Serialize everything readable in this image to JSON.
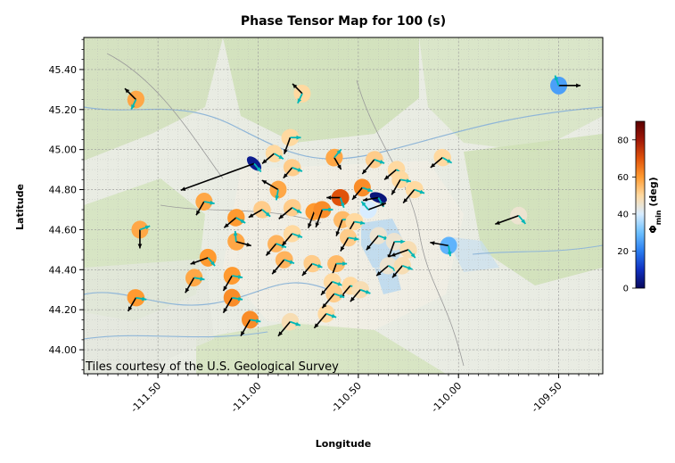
{
  "chart_data": {
    "type": "scatter",
    "title": "Phase Tensor Map for 100 (s)",
    "xlabel": "Longitude",
    "ylabel": "Latitude",
    "xlim": [
      -111.87,
      -109.28
    ],
    "ylim": [
      43.88,
      45.56
    ],
    "xticks": [
      "-111.50",
      "-111.00",
      "-110.50",
      "-110.00",
      "-109.50"
    ],
    "yticks": [
      "44.00",
      "44.20",
      "44.40",
      "44.60",
      "44.80",
      "45.00",
      "45.20",
      "45.40"
    ],
    "grid": true,
    "basemap_credit": "Tiles courtesy of the U.S. Geological Survey",
    "colorbar": {
      "label": "Φmin (deg)",
      "label_main": "Φ",
      "label_sub": "min",
      "label_rest": " (deg)",
      "min": 0,
      "max": 90,
      "ticks": [
        "0",
        "20",
        "40",
        "60",
        "80"
      ],
      "colors": [
        "#08085c",
        "#1030c0",
        "#2a7df0",
        "#6cc0ff",
        "#d8ecff",
        "#ffd9a0",
        "#ff9a30",
        "#e0520a",
        "#a01808",
        "#5a0000"
      ]
    },
    "stations": [
      {
        "lon": -111.61,
        "lat": 45.25,
        "phimin": 58,
        "az": -62,
        "ra": 0.25,
        "ta": 135
      },
      {
        "lon": -110.78,
        "lat": 45.28,
        "phimin": 50,
        "az": 75,
        "ra": 0.22,
        "ta": 135
      },
      {
        "lon": -109.5,
        "lat": 45.32,
        "phimin": 25,
        "az": 90,
        "ra": 0.35,
        "ta": 0
      },
      {
        "lon": -110.84,
        "lat": 45.06,
        "phimin": 50,
        "az": 160,
        "ra": 0.28,
        "ta": 250
      },
      {
        "lon": -110.92,
        "lat": 44.98,
        "phimin": 50,
        "az": 60,
        "ra": 0.25,
        "ta": 220
      },
      {
        "lon": -110.83,
        "lat": 44.91,
        "phimin": 52,
        "az": 30,
        "ra": 0.22,
        "ta": 230
      },
      {
        "lon": -110.62,
        "lat": 44.96,
        "phimin": 58,
        "az": 120,
        "ra": 0.22,
        "ta": 300
      },
      {
        "lon": -110.42,
        "lat": 44.95,
        "phimin": 52,
        "az": 150,
        "ra": 0.3,
        "ta": 230
      },
      {
        "lon": -110.31,
        "lat": 44.9,
        "phimin": 50,
        "az": 135,
        "ra": 0.25,
        "ta": 220
      },
      {
        "lon": -110.08,
        "lat": 44.96,
        "phimin": 50,
        "az": 40,
        "ra": 0.25,
        "ta": 220
      },
      {
        "lon": -111.02,
        "lat": 44.93,
        "phimin": 5,
        "az": 45,
        "ra": 1.25,
        "ta": 200
      },
      {
        "lon": -110.9,
        "lat": 44.8,
        "phimin": 58,
        "az": 100,
        "ra": 0.3,
        "ta": 150
      },
      {
        "lon": -110.48,
        "lat": 44.81,
        "phimin": 62,
        "az": 80,
        "ra": 0.25,
        "ta": 230
      },
      {
        "lon": -110.22,
        "lat": 44.8,
        "phimin": 50,
        "az": 150,
        "ra": 0.28,
        "ta": 230
      },
      {
        "lon": -110.29,
        "lat": 44.85,
        "phimin": 50,
        "az": 130,
        "ra": 0.28,
        "ta": 240
      },
      {
        "lon": -111.27,
        "lat": 44.74,
        "phimin": 58,
        "az": 100,
        "ra": 0.25,
        "ta": 240
      },
      {
        "lon": -111.11,
        "lat": 44.66,
        "phimin": 60,
        "az": 130,
        "ra": 0.25,
        "ta": 220
      },
      {
        "lon": -110.98,
        "lat": 44.7,
        "phimin": 52,
        "az": 40,
        "ra": 0.25,
        "ta": 210
      },
      {
        "lon": -110.83,
        "lat": 44.71,
        "phimin": 52,
        "az": 150,
        "ra": 0.28,
        "ta": 220
      },
      {
        "lon": -110.72,
        "lat": 44.69,
        "phimin": 60,
        "az": 160,
        "ra": 0.28,
        "ta": 250
      },
      {
        "lon": -110.68,
        "lat": 44.7,
        "phimin": 62,
        "az": 200,
        "ra": 0.3,
        "ta": 250
      },
      {
        "lon": -110.59,
        "lat": 44.76,
        "phimin": 70,
        "az": 180,
        "ra": 0.22,
        "ta": 180
      },
      {
        "lon": -110.58,
        "lat": 44.65,
        "phimin": 55,
        "az": 150,
        "ra": 0.28,
        "ta": 250
      },
      {
        "lon": -110.4,
        "lat": 44.76,
        "phimin": 3,
        "az": 20,
        "ra": 0.25,
        "ta": 190
      },
      {
        "lon": -110.45,
        "lat": 44.7,
        "phimin": 40,
        "az": 110,
        "ra": 0.3,
        "ta": 20
      },
      {
        "lon": -110.52,
        "lat": 44.64,
        "phimin": 50,
        "az": 160,
        "ra": 0.25,
        "ta": 240
      },
      {
        "lon": -110.4,
        "lat": 44.57,
        "phimin": 45,
        "az": 140,
        "ra": 0.3,
        "ta": 230
      },
      {
        "lon": -110.32,
        "lat": 44.54,
        "phimin": 45,
        "az": 60,
        "ra": 0.3,
        "ta": 250
      },
      {
        "lon": -110.25,
        "lat": 44.5,
        "phimin": 48,
        "az": 50,
        "ra": 0.3,
        "ta": 200
      },
      {
        "lon": -110.05,
        "lat": 44.52,
        "phimin": 28,
        "az": 120,
        "ra": 0.3,
        "ta": 170
      },
      {
        "lon": -109.7,
        "lat": 44.67,
        "phimin": 45,
        "az": 110,
        "ra": 0.4,
        "ta": 200
      },
      {
        "lon": -111.59,
        "lat": 44.6,
        "phimin": 58,
        "az": 90,
        "ra": 0.3,
        "ta": 270
      },
      {
        "lon": -111.25,
        "lat": 44.46,
        "phimin": 60,
        "az": 80,
        "ra": 0.3,
        "ta": 200
      },
      {
        "lon": -111.11,
        "lat": 44.54,
        "phimin": 58,
        "az": 60,
        "ra": 0.25,
        "ta": -15
      },
      {
        "lon": -110.91,
        "lat": 44.53,
        "phimin": 56,
        "az": 130,
        "ra": 0.25,
        "ta": 230
      },
      {
        "lon": -110.87,
        "lat": 44.45,
        "phimin": 56,
        "az": 150,
        "ra": 0.3,
        "ta": 230
      },
      {
        "lon": -110.83,
        "lat": 44.58,
        "phimin": 50,
        "az": 150,
        "ra": 0.25,
        "ta": 230
      },
      {
        "lon": -110.73,
        "lat": 44.43,
        "phimin": 52,
        "az": 40,
        "ra": 0.25,
        "ta": 230
      },
      {
        "lon": -110.61,
        "lat": 44.43,
        "phimin": 55,
        "az": 170,
        "ra": 0.3,
        "ta": 250
      },
      {
        "lon": -110.63,
        "lat": 44.34,
        "phimin": 50,
        "az": 140,
        "ra": 0.28,
        "ta": 230
      },
      {
        "lon": -110.54,
        "lat": 44.32,
        "phimin": 50,
        "az": 100,
        "ra": 0.25,
        "ta": 230
      },
      {
        "lon": -110.35,
        "lat": 44.42,
        "phimin": 45,
        "az": 150,
        "ra": 0.25,
        "ta": 220
      },
      {
        "lon": -110.28,
        "lat": 44.42,
        "phimin": 48,
        "az": 130,
        "ra": 0.25,
        "ta": 230
      },
      {
        "lon": -110.55,
        "lat": 44.56,
        "phimin": 52,
        "az": 60,
        "ra": 0.25,
        "ta": 240
      },
      {
        "lon": -111.61,
        "lat": 44.26,
        "phimin": 60,
        "az": 30,
        "ra": 0.25,
        "ta": 240
      },
      {
        "lon": -111.32,
        "lat": 44.36,
        "phimin": 58,
        "az": 120,
        "ra": 0.28,
        "ta": 240
      },
      {
        "lon": -111.13,
        "lat": 44.37,
        "phimin": 60,
        "az": 110,
        "ra": 0.28,
        "ta": 240
      },
      {
        "lon": -111.13,
        "lat": 44.26,
        "phimin": 62,
        "az": 70,
        "ra": 0.28,
        "ta": 240
      },
      {
        "lon": -111.04,
        "lat": 44.15,
        "phimin": 62,
        "az": 80,
        "ra": 0.3,
        "ta": 240
      },
      {
        "lon": -110.84,
        "lat": 44.14,
        "phimin": 48,
        "az": 130,
        "ra": 0.3,
        "ta": 230
      },
      {
        "lon": -110.66,
        "lat": 44.18,
        "phimin": 50,
        "az": 110,
        "ra": 0.3,
        "ta": 230
      },
      {
        "lon": -110.62,
        "lat": 44.28,
        "phimin": 52,
        "az": 110,
        "ra": 0.3,
        "ta": 230
      },
      {
        "lon": -110.49,
        "lat": 44.3,
        "phimin": 48,
        "az": 150,
        "ra": 0.25,
        "ta": 230
      }
    ]
  }
}
